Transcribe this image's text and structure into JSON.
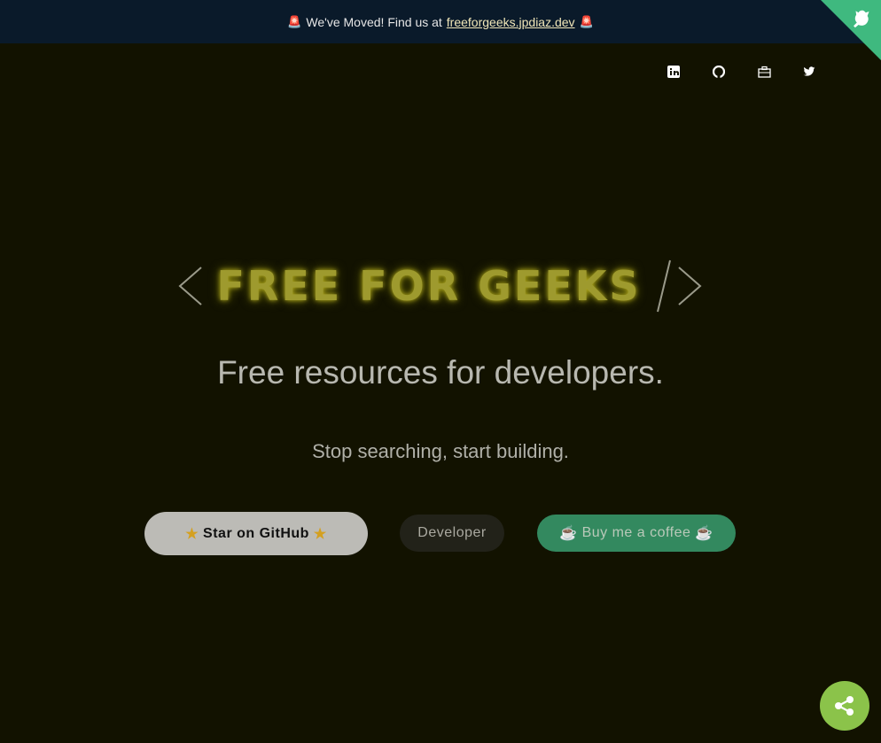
{
  "banner": {
    "prefix": "We've Moved! Find us at",
    "link": "freeforgeeks.jpdiaz.dev",
    "icon": "siren-icon"
  },
  "social": [
    "linkedin-icon",
    "github-icon",
    "portfolio-icon",
    "twitter-icon"
  ],
  "hero": {
    "title": "FREE FOR GEEKS",
    "open": "<",
    "close": "/>",
    "subtitle": "Free resources for developers.",
    "tagline": "Stop searching, start building."
  },
  "buttons": {
    "star": "Star on GitHub",
    "developer": "Developer",
    "coffee": "Buy me a coffee"
  },
  "colors": {
    "background": "#121200",
    "banner": "#0a1a2a",
    "title": "#9e9a2e",
    "coffee": "#33895f",
    "share": "#8bc34a",
    "corner": "#3fb97f"
  }
}
